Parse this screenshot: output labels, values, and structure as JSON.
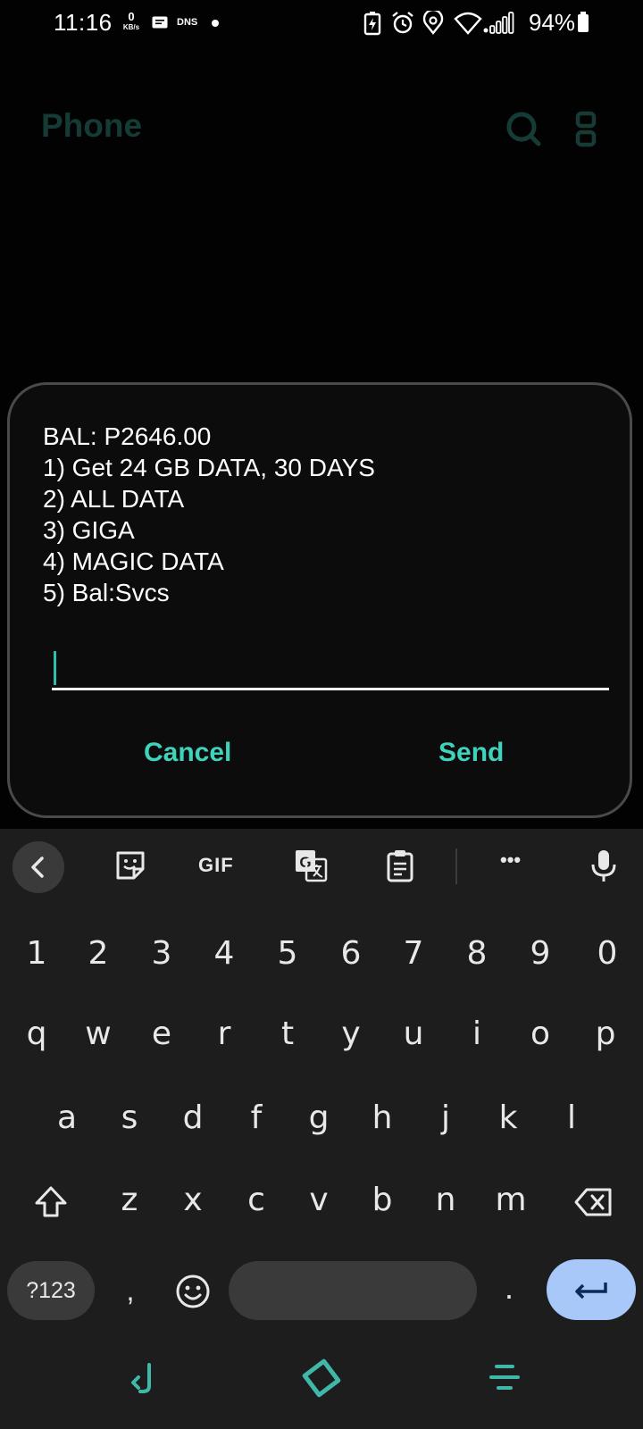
{
  "status_bar": {
    "time": "11:16",
    "net_speed_value": "0",
    "net_speed_unit": "KB/s",
    "dns_label": "DNS",
    "battery_percent": "94%"
  },
  "app": {
    "title": "Phone"
  },
  "ussd_dialog": {
    "message": "BAL: P2646.00\n1) Get 24 GB DATA, 30 DAYS\n2) ALL DATA\n3) GIGA\n4) MAGIC DATA\n5) Bal:Svcs",
    "input_value": "",
    "cancel_label": "Cancel",
    "send_label": "Send",
    "accent_color": "#3fd3bd"
  },
  "keyboard": {
    "toolbar": {
      "gif_label": "GIF",
      "more_label": "•••"
    },
    "number_row": [
      "1",
      "2",
      "3",
      "4",
      "5",
      "6",
      "7",
      "8",
      "9",
      "0"
    ],
    "row1": [
      "q",
      "w",
      "e",
      "r",
      "t",
      "y",
      "u",
      "i",
      "o",
      "p"
    ],
    "row2": [
      "a",
      "s",
      "d",
      "f",
      "g",
      "h",
      "j",
      "k",
      "l"
    ],
    "row3": [
      "z",
      "x",
      "c",
      "v",
      "b",
      "n",
      "m"
    ],
    "symbols_label": "?123",
    "comma_label": ",",
    "period_label": ".",
    "enter_color": "#a8c8fa"
  }
}
